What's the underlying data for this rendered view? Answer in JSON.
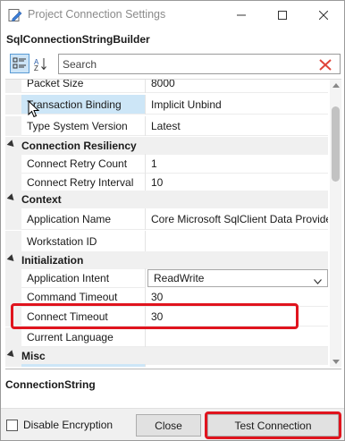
{
  "window": {
    "title": "Project Connection Settings"
  },
  "object_label": "SqlConnectionStringBuilder",
  "toolbar": {
    "search_placeholder": "Search"
  },
  "grid": {
    "rows": [
      {
        "type": "prop",
        "name": "Packet Size",
        "value": "8000"
      },
      {
        "type": "prop",
        "name": "Transaction Binding",
        "value": "Implicit Unbind",
        "selected": true
      },
      {
        "type": "prop",
        "name": "Type System Version",
        "value": "Latest"
      },
      {
        "type": "category",
        "name": "Connection Resiliency"
      },
      {
        "type": "prop",
        "name": "Connect Retry Count",
        "value": "1"
      },
      {
        "type": "prop",
        "name": "Connect Retry Interval",
        "value": "10"
      },
      {
        "type": "category",
        "name": "Context"
      },
      {
        "type": "prop",
        "name": "Application Name",
        "value": "Core Microsoft SqlClient Data Provider"
      },
      {
        "type": "prop",
        "name": "Workstation ID",
        "value": ""
      },
      {
        "type": "category",
        "name": "Initialization"
      },
      {
        "type": "prop",
        "name": "Application Intent",
        "value": "ReadWrite",
        "dropdown": true
      },
      {
        "type": "prop",
        "name": "Command Timeout",
        "value": "30"
      },
      {
        "type": "prop",
        "name": "Connect Timeout",
        "value": "30"
      },
      {
        "type": "prop",
        "name": "Current Language",
        "value": ""
      },
      {
        "type": "category",
        "name": "Misc"
      }
    ]
  },
  "description": {
    "title": "ConnectionString"
  },
  "footer": {
    "disable_encryption_label": "Disable Encryption",
    "close_label": "Close",
    "test_label": "Test Connection"
  },
  "colors": {
    "highlight": "#e0141e",
    "selection": "#cde6f7"
  }
}
